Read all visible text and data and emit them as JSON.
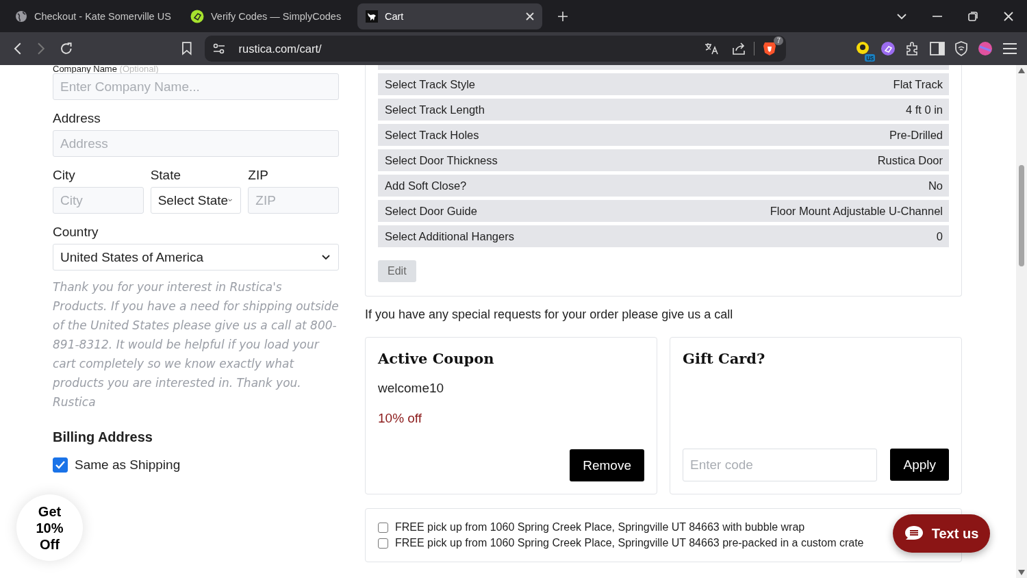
{
  "browser": {
    "tabs": [
      {
        "title": "Checkout - Kate Somerville US",
        "selected": false
      },
      {
        "title": "Verify Codes — SimplyCodes",
        "selected": false
      },
      {
        "title": "Cart",
        "selected": true
      }
    ],
    "url": "rustica.com/cart/",
    "shield_count": "7",
    "extension_badge": "us"
  },
  "form": {
    "company_label": "Company Name",
    "company_optional": "(Optional)",
    "company_placeholder": "Enter Company Name...",
    "address_label": "Address",
    "address_placeholder": "Address",
    "city_label": "City",
    "city_placeholder": "City",
    "state_label": "State",
    "state_value": "Select State",
    "zip_label": "ZIP",
    "zip_placeholder": "ZIP",
    "country_label": "Country",
    "country_value": "United States of America",
    "note": "Thank you for your interest in Rustica's Products. If you have a need for shipping outside of the United States please give us a call at 800-891-8312. It would be helpful if you load your cart completely so we know exactly what products you are interested in. Thank you. Rustica",
    "billing_heading": "Billing Address",
    "same_as_shipping": {
      "label": "Same as Shipping",
      "checked": true
    }
  },
  "options": [
    {
      "label": "Select Track Style",
      "value": "Flat Track"
    },
    {
      "label": "Select Track Length",
      "value": "4 ft 0 in"
    },
    {
      "label": "Select Track Holes",
      "value": "Pre-Drilled"
    },
    {
      "label": "Select Door Thickness",
      "value": "Rustica Door"
    },
    {
      "label": "Add Soft Close?",
      "value": "No"
    },
    {
      "label": "Select Door Guide",
      "value": "Floor Mount Adjustable U-Channel"
    },
    {
      "label": "Select Additional Hangers",
      "value": "0"
    }
  ],
  "edit_button": "Edit",
  "special_note": "If you have any special requests for your order please give us a call",
  "coupon": {
    "title": "Active Coupon",
    "code": "welcome10",
    "discount": "10% off",
    "button": "Remove"
  },
  "gift_card": {
    "title": "Gift Card?",
    "placeholder": "Enter code",
    "button": "Apply"
  },
  "shipping_options": [
    {
      "label": "FREE pick up from 1060 Spring Creek Place, Springville UT 84663 with bubble wrap",
      "checked": false
    },
    {
      "label": "FREE pick up from 1060 Spring Creek Place, Springville UT 84663 pre-packed in a custom crate",
      "checked": false
    }
  ],
  "promo_badge": "Get 10% Off",
  "chat_button": "Text us"
}
